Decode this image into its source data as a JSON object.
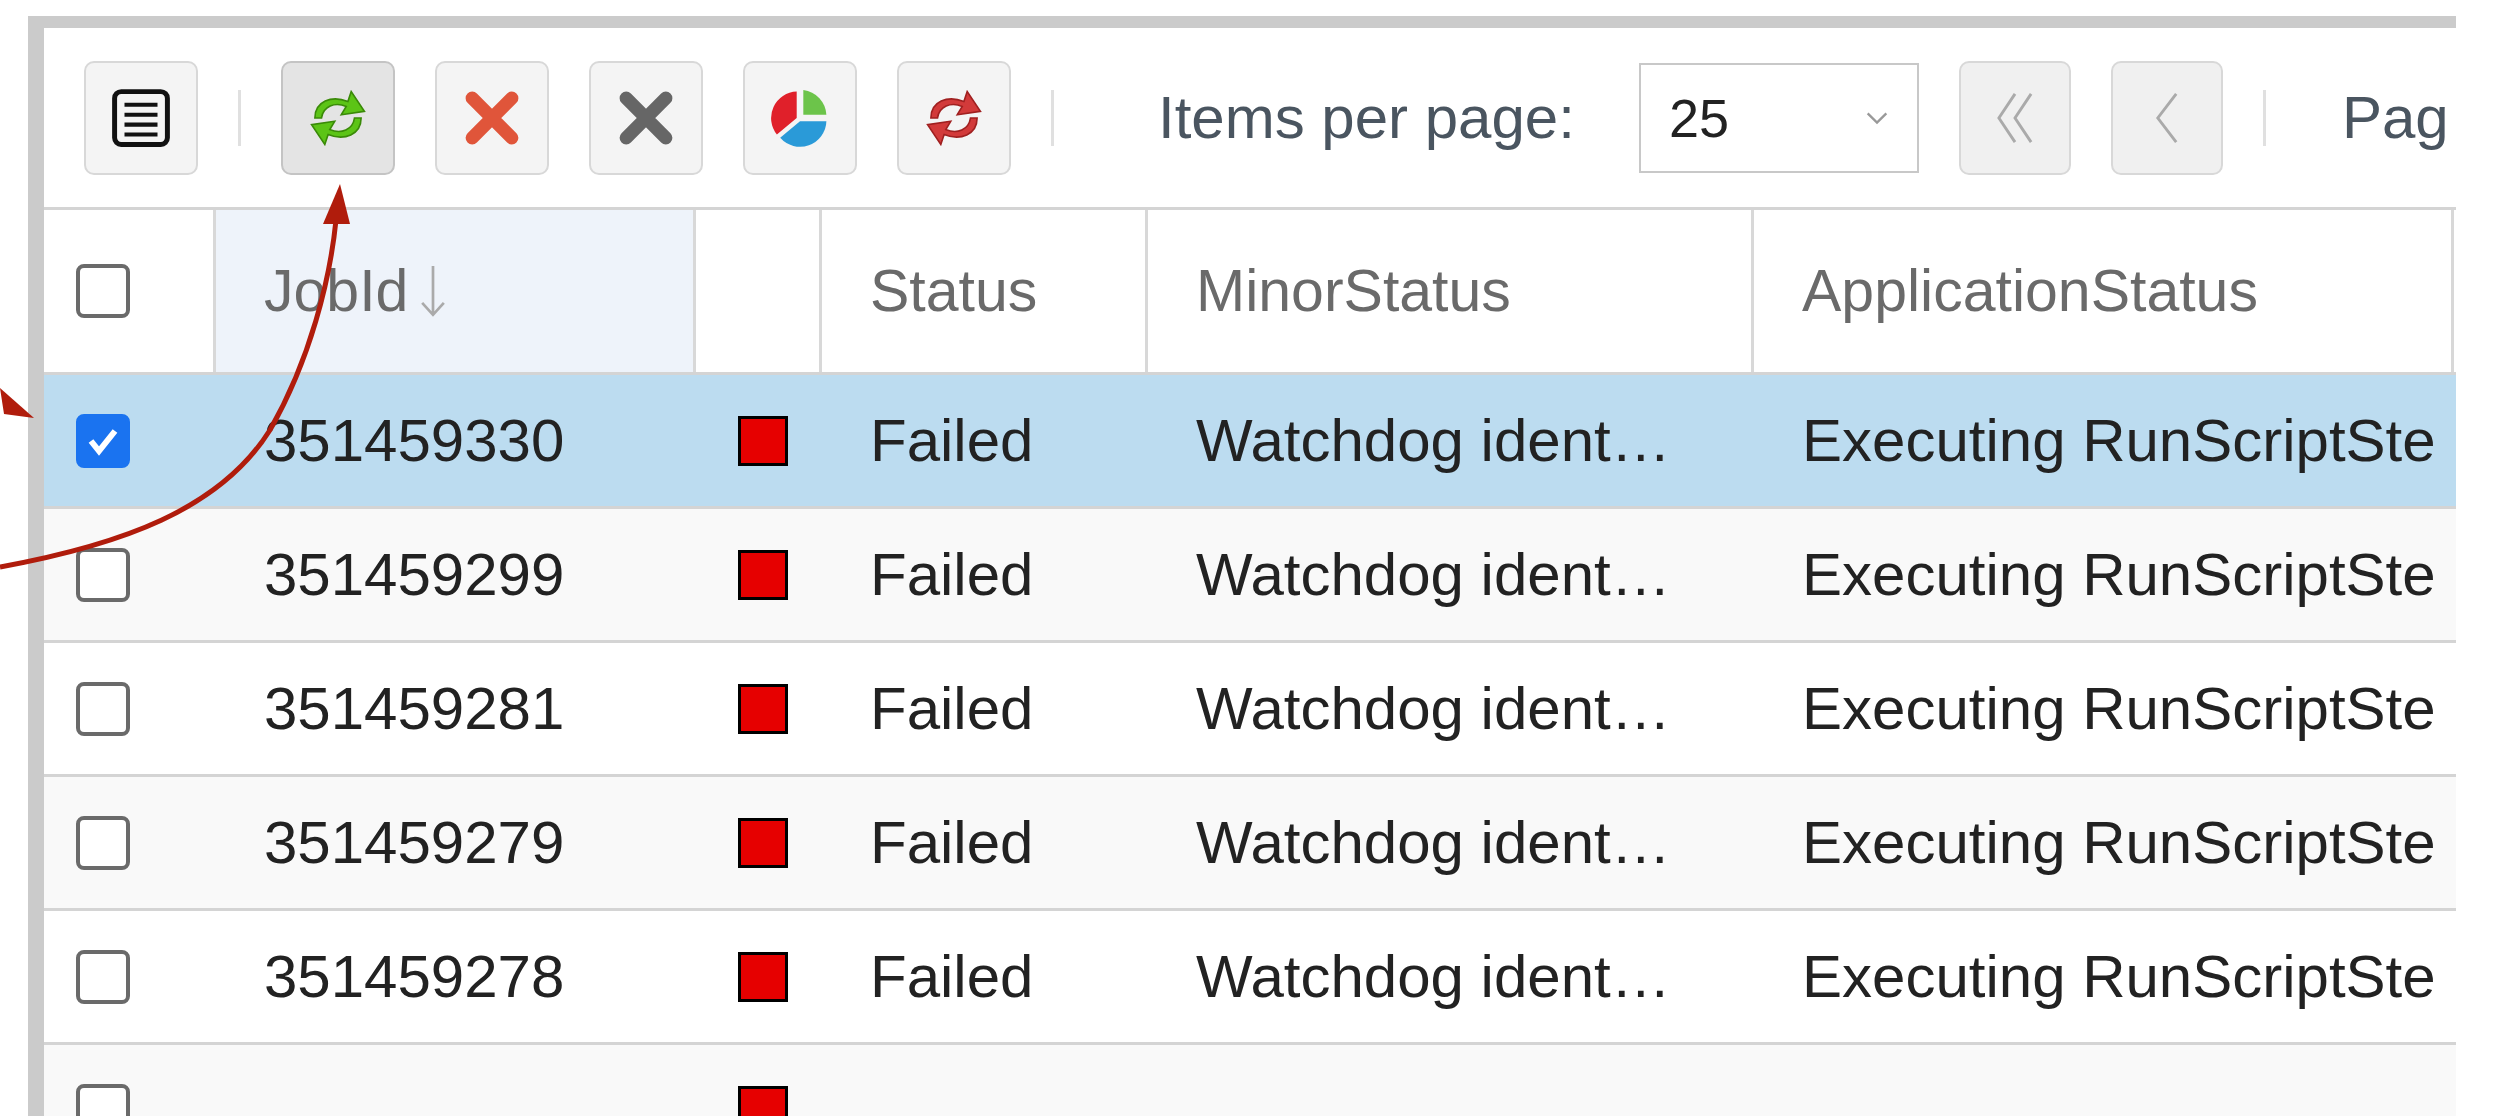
{
  "toolbar": {
    "buttons": [
      {
        "kind": "list",
        "active": false
      },
      {
        "kind": "refresh",
        "active": true
      },
      {
        "kind": "kill",
        "active": false
      },
      {
        "kind": "delete",
        "active": false
      },
      {
        "kind": "chart",
        "active": false
      },
      {
        "kind": "reschedule",
        "active": false
      }
    ],
    "items_per_page_label": "Items per page:",
    "items_per_page": "25",
    "pager_buttons": [
      {
        "kind": "first",
        "disabled": true
      },
      {
        "kind": "previous",
        "disabled": true
      }
    ],
    "page_label": "Pag"
  },
  "table": {
    "select_all": {
      "checked": false
    },
    "columns": [
      {
        "label": "JobId",
        "sorted": true
      },
      {
        "sorted": false
      },
      {
        "label": "Status",
        "sorted": false
      },
      {
        "label": "MinorStatus",
        "sorted": false
      },
      {
        "label": "ApplicationStatus",
        "sorted": false
      }
    ],
    "rows": [
      {
        "selected": true,
        "jobid": "351459330",
        "color": "#e60000",
        "status": "Failed",
        "minor_status": "Watchdog ident…",
        "application_status": "Executing RunScriptSte"
      },
      {
        "selected": false,
        "jobid": "351459299",
        "color": "#e60000",
        "status": "Failed",
        "minor_status": "Watchdog ident…",
        "application_status": "Executing RunScriptSte"
      },
      {
        "selected": false,
        "jobid": "351459281",
        "color": "#e60000",
        "status": "Failed",
        "minor_status": "Watchdog ident…",
        "application_status": "Executing RunScriptSte"
      },
      {
        "selected": false,
        "jobid": "351459279",
        "color": "#e60000",
        "status": "Failed",
        "minor_status": "Watchdog ident…",
        "application_status": "Executing RunScriptSte"
      },
      {
        "selected": false,
        "jobid": "351459278",
        "color": "#e60000",
        "status": "Failed",
        "minor_status": "Watchdog ident…",
        "application_status": "Executing RunScriptSte"
      },
      {
        "selected": false,
        "color": "#e60000"
      }
    ]
  }
}
